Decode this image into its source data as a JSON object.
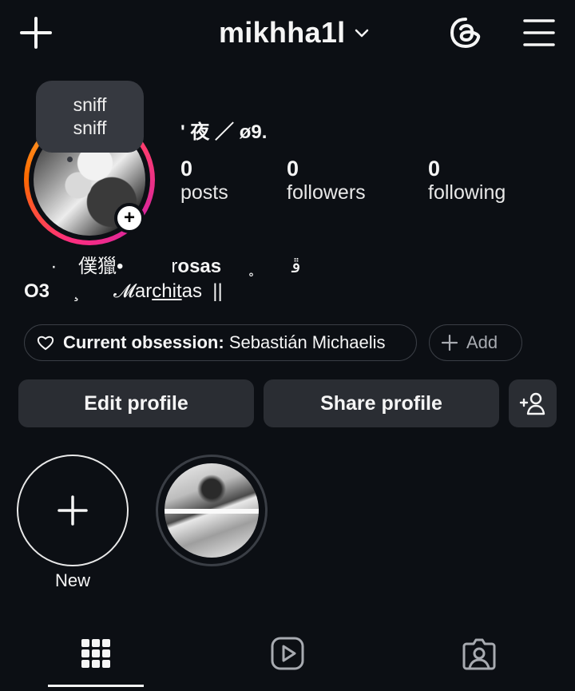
{
  "header": {
    "username": "mikhha1l"
  },
  "note": {
    "line1": "sniff",
    "line2": "sniff"
  },
  "profile": {
    "display_name": "' 夜 ／ ø9."
  },
  "stats": [
    {
      "value": "0",
      "label": "posts"
    },
    {
      "value": "0",
      "label": "followers"
    },
    {
      "value": "0",
      "label": "following"
    }
  ],
  "bio": {
    "line1_a": "  ·",
    "line1_b": "    僕獵",
    "line1_c": "•",
    "line1_d": "r",
    "line1_e": "osas",
    "line1_f": "     ˳       ﭰ",
    "line2_a": "O3",
    "line2_b": "     ̧       𝓜ar",
    "line2_c": "chit",
    "line2_d": "as  ||"
  },
  "obsession": {
    "label": "Current obsession:",
    "value": "Sebastián Michaelis",
    "add_label": "Add"
  },
  "buttons": {
    "edit": "Edit profile",
    "share": "Share profile"
  },
  "highlights": [
    {
      "label": "New"
    }
  ],
  "colors": {
    "background": "#0c0f14",
    "button": "#2a2d33",
    "note": "#363940"
  }
}
